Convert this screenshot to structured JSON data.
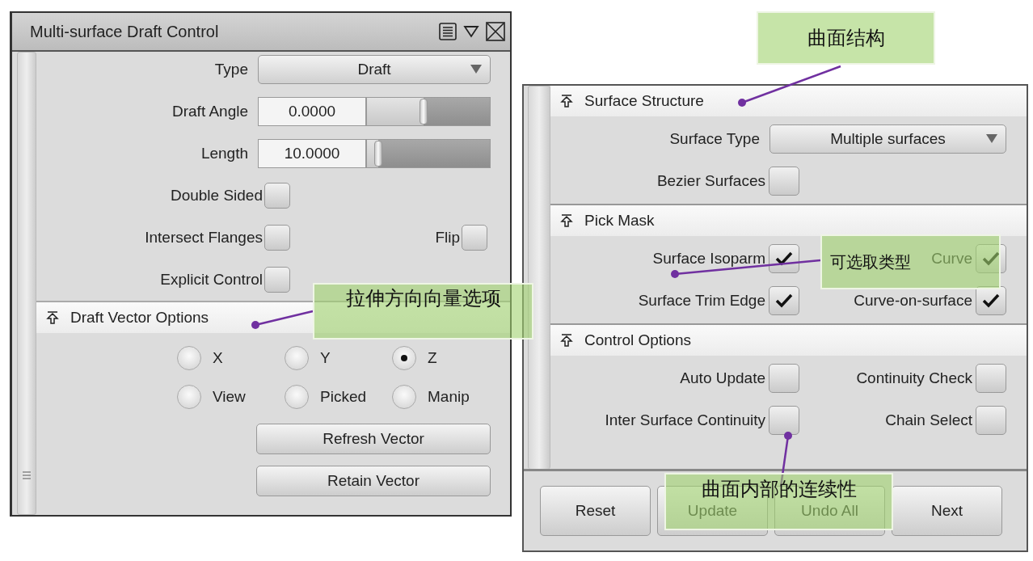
{
  "left_panel": {
    "title": "Multi-surface Draft Control",
    "rows": [
      {
        "kind": "dropdown",
        "label": "Type",
        "value": "Draft"
      },
      {
        "kind": "slider",
        "label": "Draft Angle",
        "value": "0.0000",
        "level": 0.46
      },
      {
        "kind": "slider",
        "label": "Length",
        "value": "10.0000",
        "level": 0.09
      },
      {
        "kind": "checks",
        "items": [
          {
            "label": "Double Sided",
            "checked": false
          }
        ]
      },
      {
        "kind": "checks",
        "items": [
          {
            "label": "Intersect Flanges",
            "checked": false
          },
          {
            "label": "Flip",
            "checked": false
          }
        ]
      },
      {
        "kind": "checks",
        "items": [
          {
            "label": "Explicit Control",
            "checked": false
          }
        ]
      }
    ],
    "section": {
      "title": "Draft Vector Options",
      "radios": [
        {
          "label": "X",
          "selected": false
        },
        {
          "label": "Y",
          "selected": false
        },
        {
          "label": "Z",
          "selected": true
        },
        {
          "label": "View",
          "selected": false
        },
        {
          "label": "Picked",
          "selected": false
        },
        {
          "label": "Manip",
          "selected": false
        }
      ],
      "buttons": [
        "Refresh Vector",
        "Retain Vector"
      ]
    }
  },
  "right_panel": {
    "sections": [
      {
        "title": "Surface Structure",
        "rows": [
          {
            "kind": "dropdown",
            "label": "Surface Type",
            "value": "Multiple surfaces"
          },
          {
            "kind": "checks",
            "items": [
              {
                "label": "Bezier Surfaces",
                "checked": false
              }
            ]
          }
        ]
      },
      {
        "title": "Pick Mask",
        "rows": [
          {
            "kind": "checks",
            "items": [
              {
                "label": "Surface Isoparm",
                "checked": true
              },
              {
                "label": "Curve",
                "checked": true
              }
            ]
          },
          {
            "kind": "checks",
            "items": [
              {
                "label": "Surface Trim Edge",
                "checked": true
              },
              {
                "label": "Curve-on-surface",
                "checked": true
              }
            ]
          }
        ]
      },
      {
        "title": "Control Options",
        "rows": [
          {
            "kind": "checks",
            "items": [
              {
                "label": "Auto Update",
                "checked": false
              },
              {
                "label": "Continuity Check",
                "checked": false
              }
            ]
          },
          {
            "kind": "checks",
            "items": [
              {
                "label": "Inter Surface Continuity",
                "checked": false
              },
              {
                "label": "Chain Select",
                "checked": false
              }
            ]
          }
        ]
      }
    ],
    "buttons": [
      "Reset",
      "Update",
      "Undo All",
      "Next"
    ]
  },
  "annotations": [
    {
      "text": "曲面结构"
    },
    {
      "text": "拉伸方向向量选项"
    },
    {
      "text": "可选取类型"
    },
    {
      "text": "曲面内部的连续性"
    }
  ]
}
